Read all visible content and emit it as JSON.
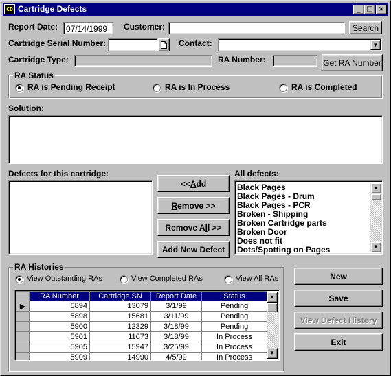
{
  "window": {
    "title": "Cartridge Defects",
    "app_icon_text": "CD",
    "minimize": "_",
    "maximize": "□",
    "close": "×"
  },
  "header": {
    "report_date_label": "Report Date:",
    "report_date_value": "07/14/1999",
    "customer_label": "Customer:",
    "customer_value": "",
    "search_button": "Search",
    "serial_label": "Cartridge Serial Number:",
    "serial_value": "",
    "contact_label": "Contact:",
    "contact_value": "",
    "cartridge_type_label": "Cartridge Type:",
    "cartridge_type_value": "",
    "ra_number_label": "RA Number:",
    "ra_number_value": "",
    "get_ra_button": "Get RA Number"
  },
  "ra_status": {
    "title": "RA Status",
    "options": [
      {
        "label": "RA is Pending Receipt",
        "selected": true
      },
      {
        "label": "RA is In Process",
        "selected": false
      },
      {
        "label": "RA is Completed",
        "selected": false
      }
    ]
  },
  "solution": {
    "label": "Solution:",
    "value": ""
  },
  "defects": {
    "current_label": "Defects for this cartridge:",
    "current_items": [],
    "all_label": "All defects:",
    "all_items": [
      "Black Pages",
      "Black Pages - Drum",
      "Black Pages - PCR",
      "Broken - Shipping",
      "Broken Cartridge parts",
      "Broken Door",
      "Does not fit",
      "Dots/Spotting on Pages"
    ],
    "add_prefix": "<< ",
    "add_key": "A",
    "add_rest": "dd",
    "remove_key": "R",
    "remove_rest": "emove >>",
    "remove_all_prefix": "Remove A",
    "remove_all_key": "l",
    "remove_all_rest": "l >>",
    "add_new_button": "Add New Defect"
  },
  "ra_histories": {
    "title": "RA Histories",
    "filters": [
      {
        "label": "View Outstanding RAs",
        "selected": true
      },
      {
        "label": "View Completed RAs",
        "selected": false
      },
      {
        "label": "View All RAs",
        "selected": false
      }
    ],
    "columns": [
      "RA Number",
      "Cartridge SN",
      "Report Date",
      "Status"
    ],
    "rows": [
      {
        "ra": "5894",
        "sn": "13079",
        "date": "3/1/99",
        "status": "Pending",
        "current": true
      },
      {
        "ra": "5898",
        "sn": "15681",
        "date": "3/11/99",
        "status": "Pending",
        "current": false
      },
      {
        "ra": "5900",
        "sn": "12329",
        "date": "3/18/99",
        "status": "Pending",
        "current": false
      },
      {
        "ra": "5901",
        "sn": "11673",
        "date": "3/18/99",
        "status": "In Process",
        "current": false
      },
      {
        "ra": "5905",
        "sn": "15947",
        "date": "3/25/99",
        "status": "In Process",
        "current": false
      },
      {
        "ra": "5909",
        "sn": "14990",
        "date": "4/5/99",
        "status": "In Process",
        "current": false
      }
    ]
  },
  "actions": {
    "new": "New",
    "save": "Save",
    "view_history": "View Defect History",
    "exit_prefix": "E",
    "exit_key": "x",
    "exit_rest": "it"
  },
  "icons": {
    "scroll_up": "▲",
    "scroll_down": "▼",
    "dropdown": "▼",
    "row_pointer": "▶"
  }
}
